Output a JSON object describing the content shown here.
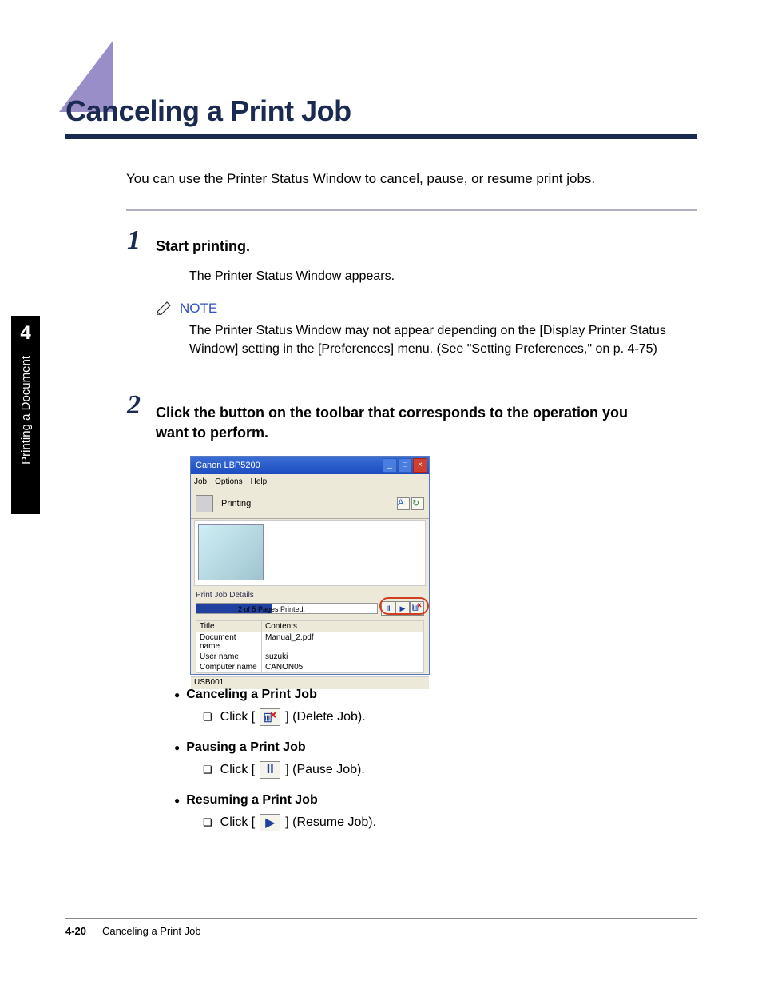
{
  "chapter": {
    "number": "4",
    "label": "Printing a Document"
  },
  "title": "Canceling a Print Job",
  "intro": "You can use the Printer Status Window to cancel, pause, or resume print jobs.",
  "step1": {
    "num": "1",
    "title": "Start printing.",
    "body": "The Printer Status Window appears."
  },
  "note": {
    "label": "NOTE",
    "text": "The Printer Status Window may not appear depending on the [Display Printer Status Window] setting in the [Preferences] menu. (See \"Setting Preferences,\" on p. 4-75)"
  },
  "step2": {
    "num": "2",
    "title": "Click the button on the toolbar that corresponds to the operation you want to perform."
  },
  "screenshot": {
    "window_title": "Canon LBP5200",
    "menus": {
      "job": "Job",
      "options": "Options",
      "help": "Help"
    },
    "status": "Printing",
    "section_label": "Print Job Details",
    "progress_text": "2 of 5 Pages Printed.",
    "table": {
      "headers": {
        "title": "Title",
        "contents": "Contents"
      },
      "rows": [
        {
          "title": "Document name",
          "contents": "Manual_2.pdf"
        },
        {
          "title": "User name",
          "contents": "suzuki"
        },
        {
          "title": "Computer name",
          "contents": "CANON05"
        }
      ]
    },
    "statusbar": "USB001"
  },
  "actions": {
    "cancel": {
      "head": "Canceling a Print Job",
      "pre": "Click [",
      "post": "] (Delete Job)."
    },
    "pause": {
      "head": "Pausing a Print Job",
      "pre": "Click [",
      "post": "] (Pause Job)."
    },
    "resume": {
      "head": "Resuming a Print Job",
      "pre": "Click [",
      "post": "] (Resume Job)."
    }
  },
  "footer": {
    "pagenum": "4-20",
    "title": "Canceling a Print Job"
  }
}
